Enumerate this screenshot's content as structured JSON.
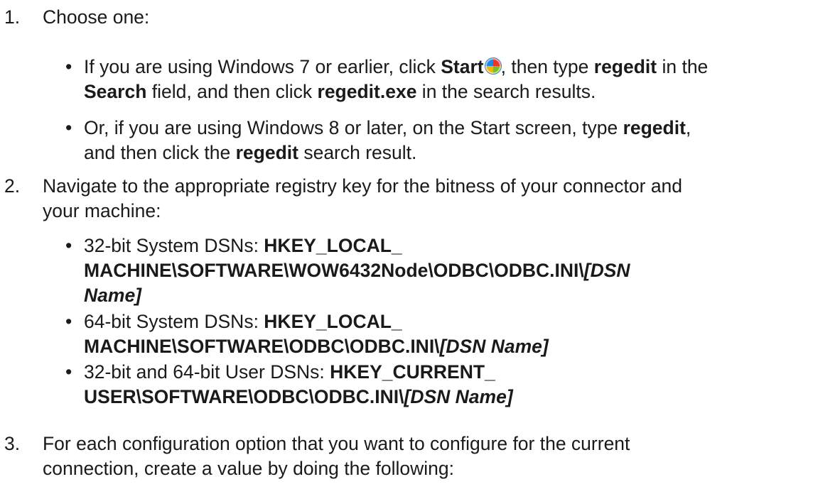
{
  "step1": {
    "number": "1.",
    "intro": "Choose one:",
    "b1": {
      "t1": "If you are using Windows 7 or earlier, click ",
      "start": "Start",
      "start_icon": "windows-start-orb-icon",
      "t2": ", then type ",
      "regedit": "regedit",
      "t3": " in the",
      "search": "Search",
      "t4": " field, and then click ",
      "exe": "regedit.exe",
      "t5": " in the search results."
    },
    "b2": {
      "t1": "Or, if you are using Windows 8 or later, on the Start screen, type ",
      "regedit": "regedit",
      "t2": ",",
      "t3": "and then click the ",
      "regedit2": "regedit",
      "t4": " search result."
    }
  },
  "step2": {
    "number": "2.",
    "line1": "Navigate to the appropriate registry key for the bitness of your connector and",
    "line2": "your machine:",
    "b1": {
      "label": "32-bit System DSNs: ",
      "key1": "HKEY_LOCAL_",
      "key2": "MACHINE\\SOFTWARE\\WOW6432Node\\ODBC\\ODBC.INI\\",
      "dsn1": "[DSN",
      "dsn2": "Name]"
    },
    "b2": {
      "label": "64-bit System DSNs: ",
      "key1": "HKEY_LOCAL_",
      "key2": "MACHINE\\SOFTWARE\\ODBC\\ODBC.INI\\",
      "dsn": "[DSN Name]"
    },
    "b3": {
      "label": "32-bit and 64-bit User DSNs: ",
      "key1": "HKEY_CURRENT_",
      "key2": "USER\\SOFTWARE\\ODBC\\ODBC.INI\\",
      "dsn": "[DSN Name]"
    }
  },
  "step3": {
    "number": "3.",
    "line1": "For each configuration option that you want to configure for the current",
    "line2": "connection, create a value by doing the following:"
  }
}
